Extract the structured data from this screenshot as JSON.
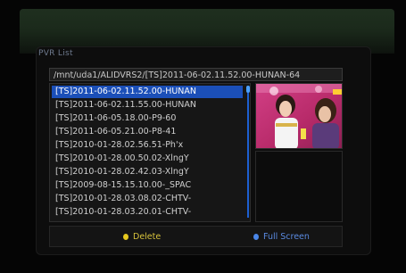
{
  "window": {
    "title": "PVR List"
  },
  "path": {
    "text": "/mnt/uda1/ALIDVRS2/[TS]2011-06-02.11.52.00-HUNAN-64"
  },
  "files": [
    "[TS]2011-06-02.11.52.00-HUNAN",
    "[TS]2011-06-02.11.55.00-HUNAN",
    "[TS]2011-06-05.18.00-P9-60",
    "[TS]2011-06-05.21.00-P8-41",
    "[TS]2010-01-28.02.56.51-Ph'x",
    "[TS]2010-01-28.00.50.02-XlngY",
    "[TS]2010-01-28.02.42.03-XlngY",
    "[TS]2009-08-15.15.10.00-_SPAC",
    "[TS]2010-01-28.03.08.02-CHTV-",
    "[TS]2010-01-28.03.20.01-CHTV-"
  ],
  "selected_index": 0,
  "footer": {
    "delete_label": "Delete",
    "fullscreen_label": "Full Screen"
  },
  "colors": {
    "delete_dot": "#e6c81e",
    "delete_text": "#d6c23c",
    "fullscreen_dot": "#4a86e8",
    "fullscreen_text": "#5a8ae0",
    "selection": "#1b4fb8"
  }
}
